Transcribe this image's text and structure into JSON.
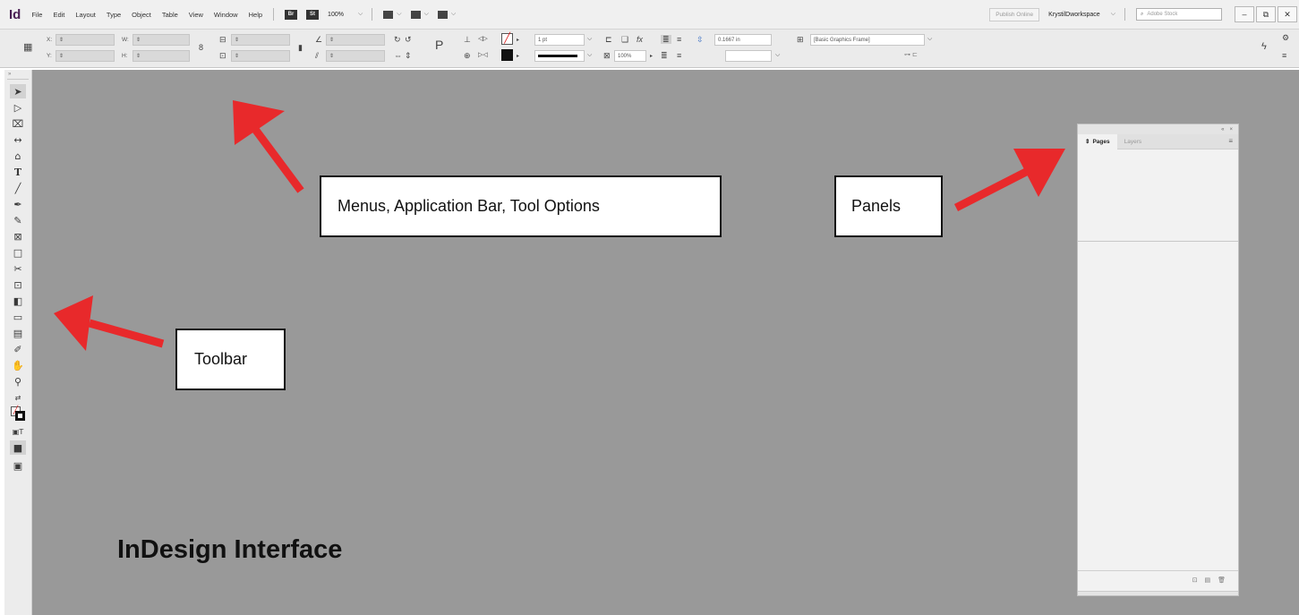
{
  "menubar": {
    "app_icon": "Id",
    "items": [
      "File",
      "Edit",
      "Layout",
      "Type",
      "Object",
      "Table",
      "View",
      "Window",
      "Help"
    ],
    "bridge_label": "Br",
    "stock_label": "St",
    "zoom": "100%",
    "publish_label": "Publish Online",
    "workspace": "KrystilDworkspace",
    "search_placeholder": "Adobe Stock",
    "window_buttons": [
      "–",
      "⧉",
      "✕"
    ]
  },
  "control": {
    "x_label": "X:",
    "y_label": "Y:",
    "w_label": "W:",
    "h_label": "H:",
    "stroke_weight": "1 pt",
    "opacity": "100%",
    "spacing": "0.1667 in",
    "object_style": "[Basic Graphics Frame]"
  },
  "callouts": {
    "menus": "Menus, Application Bar, Tool Options",
    "panels": "Panels",
    "toolbar": "Toolbar"
  },
  "title": "InDesign Interface",
  "panel": {
    "tabs": [
      "Pages",
      "Layers"
    ],
    "top_buttons": [
      "«",
      "×"
    ]
  },
  "arrow_color": "#e8292b"
}
